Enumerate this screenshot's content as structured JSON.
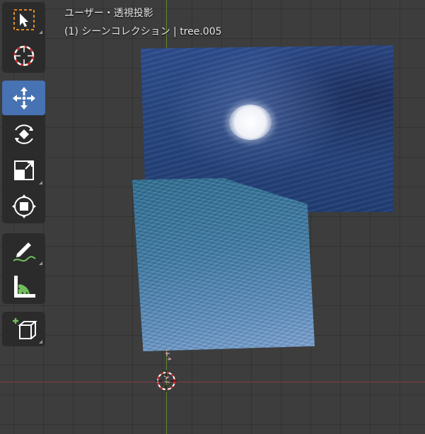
{
  "viewport": {
    "title": "ユーザー・透視投影",
    "subtitle": "(1) シーンコレクション | tree.005"
  },
  "toolbar": {
    "active_tool": "move",
    "tools": [
      {
        "name": "select-box",
        "icon": "select-box-icon",
        "has_submenu": true
      },
      {
        "name": "cursor",
        "icon": "cursor-icon",
        "has_submenu": false
      },
      {
        "name": "move",
        "icon": "move-icon",
        "has_submenu": false
      },
      {
        "name": "rotate",
        "icon": "rotate-icon",
        "has_submenu": false
      },
      {
        "name": "scale",
        "icon": "scale-icon",
        "has_submenu": true
      },
      {
        "name": "transform",
        "icon": "transform-icon",
        "has_submenu": false
      },
      {
        "name": "annotate",
        "icon": "annotate-icon",
        "has_submenu": true
      },
      {
        "name": "measure",
        "icon": "measure-icon",
        "has_submenu": false
      },
      {
        "name": "add-cube",
        "icon": "add-cube-icon",
        "has_submenu": true
      }
    ]
  },
  "colors": {
    "background": "#3d3d3d",
    "toolbar": "#2b2b2b",
    "active_tool": "#4772b3",
    "x_axis": "#8a3a44",
    "y_axis": "#5d8a2e",
    "sky": "#27467f",
    "sea": "#3d7aa4"
  }
}
